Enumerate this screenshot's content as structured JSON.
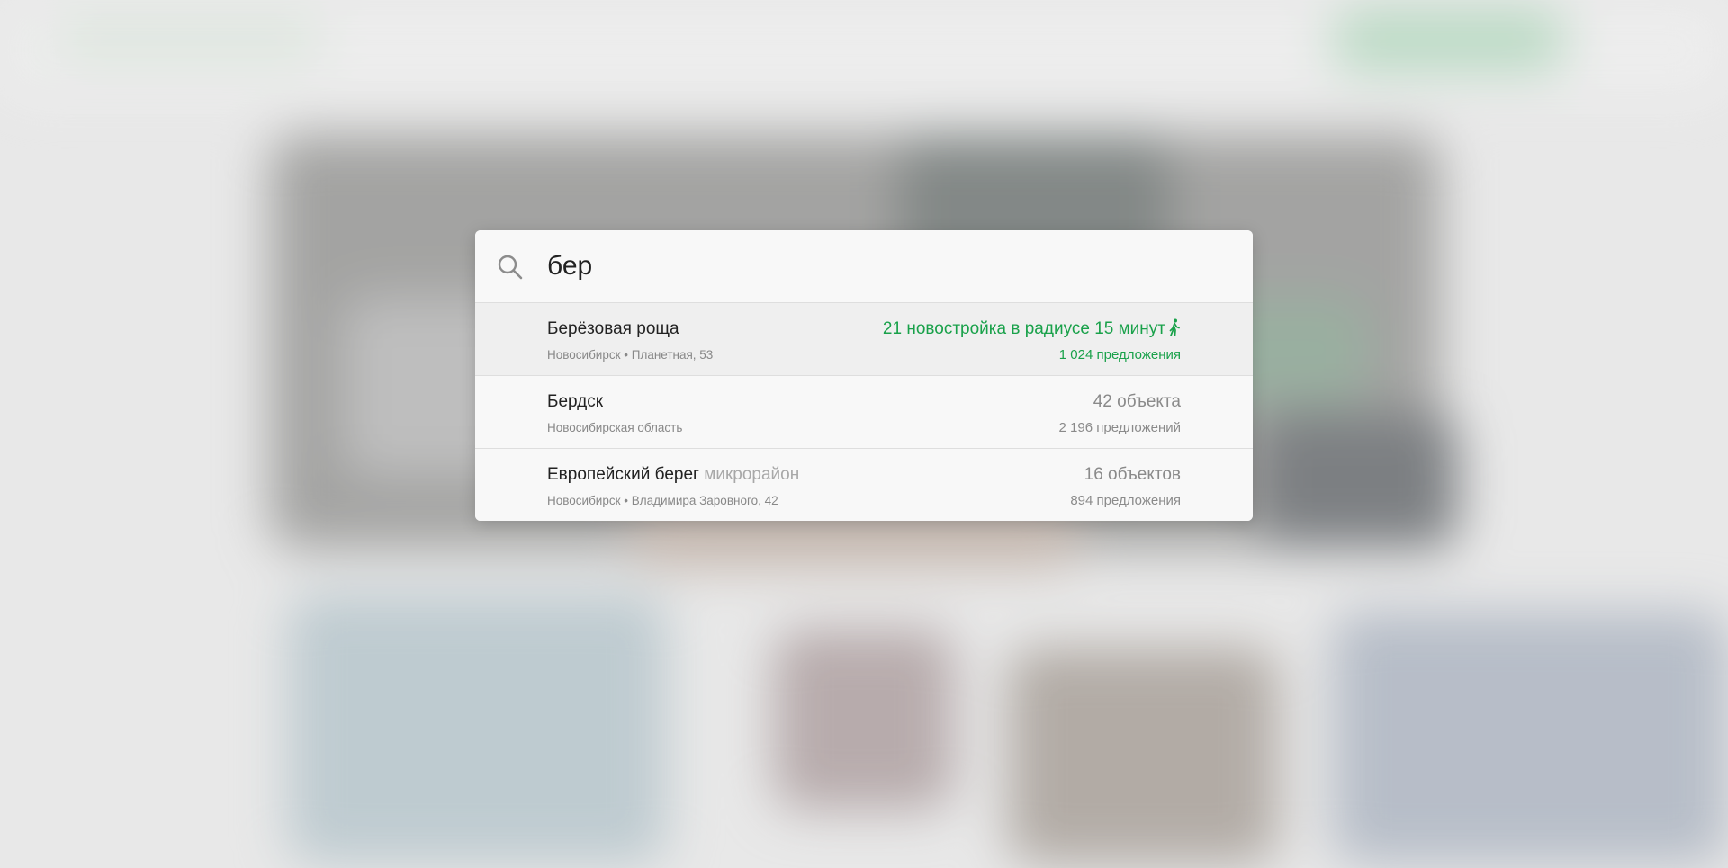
{
  "search": {
    "query": "бер",
    "placeholder": ""
  },
  "results": [
    {
      "title": "Берёзовая роща",
      "type": "",
      "subtitle": "Новосибирск • Планетная, 53",
      "right_top": "21 новостройка в радиусе 15 минут",
      "right_bottom": "1 024 предложения",
      "highlight": true,
      "icon": "walking-person-icon"
    },
    {
      "title": "Бердск",
      "type": "",
      "subtitle": "Новосибирская область",
      "right_top": "42 объекта",
      "right_bottom": "2 196 предложений",
      "highlight": false
    },
    {
      "title": "Европейский берег",
      "type": "микрорайон",
      "subtitle": "Новосибирск • Владимира Заровного, 42",
      "right_top": "16 объектов",
      "right_bottom": "894 предложения",
      "highlight": false
    }
  ],
  "colors": {
    "accent_green": "#19a14a",
    "muted_text": "#8a8a8a",
    "primary_text": "#222222"
  }
}
